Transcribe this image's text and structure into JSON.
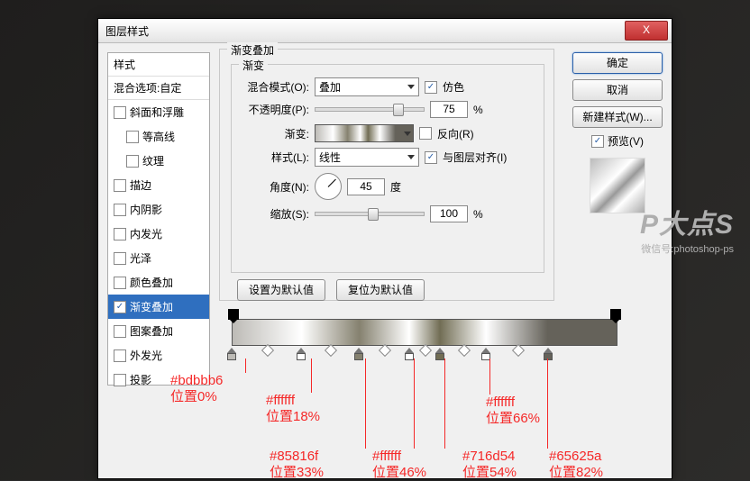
{
  "title": "图层样式",
  "ok": "确定",
  "cancel": "取消",
  "newstyle": "新建样式(W)...",
  "preview": "预览(V)",
  "styles": {
    "header": "样式",
    "blend": "混合选项:自定",
    "items": [
      "斜面和浮雕",
      "等高线",
      "纹理",
      "描边",
      "内阴影",
      "内发光",
      "光泽",
      "颜色叠加",
      "渐变叠加",
      "图案叠加",
      "外发光",
      "投影"
    ],
    "checked": {
      "8": true
    }
  },
  "group": "渐变叠加",
  "inner": "渐变",
  "blendmode": {
    "label": "混合模式(O):",
    "value": "叠加",
    "dither": "仿色"
  },
  "opacity": {
    "label": "不透明度(P):",
    "value": "75",
    "unit": "%"
  },
  "grad": {
    "label": "渐变:",
    "reverse": "反向(R)"
  },
  "style": {
    "label": "样式(L):",
    "value": "线性",
    "align": "与图层对齐(I)"
  },
  "angle": {
    "label": "角度(N):",
    "value": "45",
    "unit": "度"
  },
  "scale": {
    "label": "缩放(S):",
    "value": "100",
    "unit": "%"
  },
  "makedef": "设置为默认值",
  "resetdef": "复位为默认值",
  "stops": [
    {
      "pct": 0,
      "color": "#bdbbb6"
    },
    {
      "pct": 18,
      "color": "#ffffff"
    },
    {
      "pct": 33,
      "color": "#85816f"
    },
    {
      "pct": 46,
      "color": "#ffffff"
    },
    {
      "pct": 54,
      "color": "#716d54"
    },
    {
      "pct": 66,
      "color": "#ffffff"
    },
    {
      "pct": 82,
      "color": "#65625a"
    }
  ],
  "ann": {
    "a0": {
      "c": "#bdbbb6",
      "p": "位置0%"
    },
    "a1": {
      "c": "#ffffff",
      "p": "位置18%"
    },
    "a2": {
      "c": "#85816f",
      "p": "位置33%"
    },
    "a3": {
      "c": "#ffffff",
      "p": "位置46%"
    },
    "a4": {
      "c": "#716d54",
      "p": "位置54%"
    },
    "a5": {
      "c": "#ffffff",
      "p": "位置66%"
    },
    "a6": {
      "c": "#65625a",
      "p": "位置82%"
    }
  },
  "wm": {
    "big": "P大点S",
    "sm": "微信号:photoshop-ps"
  }
}
